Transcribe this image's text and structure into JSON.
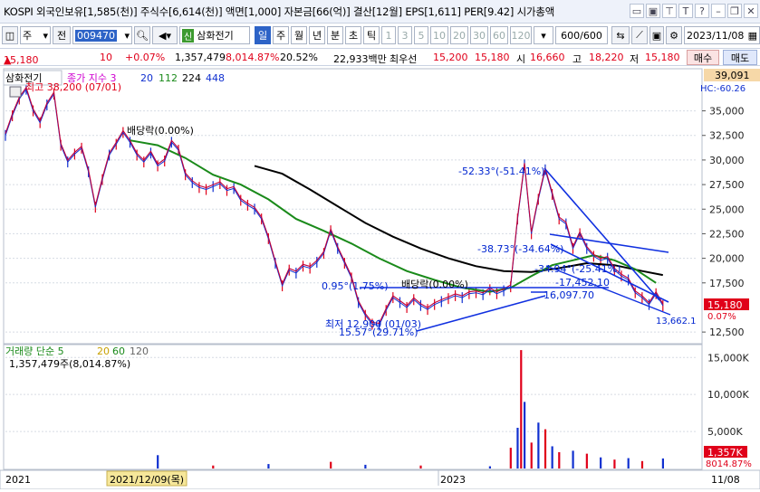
{
  "header": {
    "title": "KOSPI 외국인보유[1,585(천)] 주식수[6,614(천)] 액면[1,000] 자본금[66(억)] 결산[12월] EPS[1,611] PER[9.42] 시가총액"
  },
  "toolbar": {
    "type_select": "주",
    "type_btn": "전",
    "code": "009470",
    "badge": "신",
    "stock_name": "삼화전기",
    "period_tabs": [
      "일",
      "주",
      "월",
      "년",
      "분",
      "초",
      "틱"
    ],
    "active_period": "일",
    "intervals": [
      "1",
      "3",
      "5",
      "10",
      "20",
      "30",
      "60",
      "120"
    ],
    "count": "600/600",
    "date": "2023/11/08"
  },
  "quote": {
    "price": "15,180",
    "change": "10",
    "change_pct": "+0.07%",
    "volume": "1,357,479",
    "volume_pct": "8,014.87%",
    "turnover": "20.52%",
    "amount": "22,933백만",
    "pref_label": "최우선",
    "ask": "15,200",
    "bid": "15,180",
    "open_label": "시",
    "open": "16,660",
    "high_label": "고",
    "high": "18,220",
    "low_label": "저",
    "low": "15,180",
    "buy_btn": "매수",
    "sell_btn": "매도"
  },
  "chart_data": [
    {
      "type": "line",
      "title": "삼화전기",
      "legend": [
        "종가 지수 3",
        "20",
        "112",
        "224",
        "448"
      ],
      "legend_colors": [
        "#d000d0",
        "#1030d0",
        "#1a8a1a",
        "#000000",
        "#1030d0"
      ],
      "y_ticks": [
        "35,000",
        "32,500",
        "30,000",
        "27,500",
        "25,000",
        "22,500",
        "20,000",
        "17,500",
        "12,500"
      ],
      "y_top_label": "39,091",
      "hc_label": "HC:-60.26",
      "current_price_label": "15,180",
      "current_pct_label": "0.07%",
      "ylim": [
        11500,
        39100
      ],
      "price_line": [
        [
          0,
          32500
        ],
        [
          0.01,
          34500
        ],
        [
          0.02,
          36200
        ],
        [
          0.03,
          37200
        ],
        [
          0.04,
          35000
        ],
        [
          0.05,
          33800
        ],
        [
          0.06,
          35600
        ],
        [
          0.07,
          36700
        ],
        [
          0.08,
          31500
        ],
        [
          0.09,
          29800
        ],
        [
          0.1,
          30600
        ],
        [
          0.11,
          31200
        ],
        [
          0.12,
          28800
        ],
        [
          0.13,
          25200
        ],
        [
          0.14,
          28000
        ],
        [
          0.15,
          30500
        ],
        [
          0.16,
          31600
        ],
        [
          0.17,
          32800
        ],
        [
          0.18,
          31800
        ],
        [
          0.19,
          30500
        ],
        [
          0.2,
          29800
        ],
        [
          0.21,
          30700
        ],
        [
          0.22,
          29400
        ],
        [
          0.23,
          29900
        ],
        [
          0.24,
          31800
        ],
        [
          0.25,
          31000
        ],
        [
          0.26,
          28500
        ],
        [
          0.27,
          27700
        ],
        [
          0.28,
          27200
        ],
        [
          0.29,
          27000
        ],
        [
          0.3,
          27300
        ],
        [
          0.31,
          27600
        ],
        [
          0.32,
          26900
        ],
        [
          0.33,
          27100
        ],
        [
          0.34,
          25900
        ],
        [
          0.35,
          25400
        ],
        [
          0.36,
          25000
        ],
        [
          0.37,
          24000
        ],
        [
          0.38,
          22000
        ],
        [
          0.39,
          19500
        ],
        [
          0.4,
          17200
        ],
        [
          0.41,
          18800
        ],
        [
          0.42,
          18500
        ],
        [
          0.43,
          19200
        ],
        [
          0.44,
          19000
        ],
        [
          0.45,
          19600
        ],
        [
          0.46,
          20500
        ],
        [
          0.47,
          22800
        ],
        [
          0.48,
          21000
        ],
        [
          0.49,
          19500
        ],
        [
          0.5,
          18000
        ],
        [
          0.51,
          15500
        ],
        [
          0.52,
          14200
        ],
        [
          0.53,
          13300
        ],
        [
          0.54,
          13200
        ],
        [
          0.55,
          14700
        ],
        [
          0.56,
          16000
        ],
        [
          0.57,
          15500
        ],
        [
          0.58,
          15000
        ],
        [
          0.59,
          15800
        ],
        [
          0.6,
          15200
        ],
        [
          0.61,
          14800
        ],
        [
          0.62,
          15300
        ],
        [
          0.63,
          15600
        ],
        [
          0.64,
          15900
        ],
        [
          0.65,
          16200
        ],
        [
          0.66,
          16000
        ],
        [
          0.67,
          16400
        ],
        [
          0.68,
          16500
        ],
        [
          0.69,
          16300
        ],
        [
          0.7,
          16800
        ],
        [
          0.71,
          16400
        ],
        [
          0.72,
          16700
        ],
        [
          0.73,
          17100
        ],
        [
          0.74,
          24000
        ],
        [
          0.75,
          29500
        ],
        [
          0.76,
          22500
        ],
        [
          0.77,
          26000
        ],
        [
          0.78,
          29000
        ],
        [
          0.79,
          26500
        ],
        [
          0.8,
          24000
        ],
        [
          0.81,
          23500
        ],
        [
          0.82,
          21000
        ],
        [
          0.83,
          22500
        ],
        [
          0.84,
          21000
        ],
        [
          0.85,
          20200
        ],
        [
          0.86,
          19800
        ],
        [
          0.87,
          20000
        ],
        [
          0.88,
          18800
        ],
        [
          0.89,
          18200
        ],
        [
          0.9,
          17800
        ],
        [
          0.91,
          16500
        ],
        [
          0.92,
          16000
        ],
        [
          0.93,
          15300
        ],
        [
          0.94,
          16400
        ],
        [
          0.95,
          15180
        ]
      ],
      "ma_green": [
        [
          0.18,
          32000
        ],
        [
          0.22,
          31500
        ],
        [
          0.26,
          30200
        ],
        [
          0.3,
          28500
        ],
        [
          0.34,
          27500
        ],
        [
          0.38,
          26000
        ],
        [
          0.42,
          24000
        ],
        [
          0.46,
          22800
        ],
        [
          0.5,
          21500
        ],
        [
          0.54,
          20000
        ],
        [
          0.58,
          18700
        ],
        [
          0.62,
          17800
        ],
        [
          0.66,
          17000
        ],
        [
          0.7,
          16600
        ],
        [
          0.73,
          17000
        ],
        [
          0.76,
          18200
        ],
        [
          0.79,
          19300
        ],
        [
          0.82,
          19800
        ],
        [
          0.85,
          20300
        ],
        [
          0.88,
          19800
        ],
        [
          0.91,
          18900
        ],
        [
          0.94,
          17500
        ]
      ],
      "ma_black": [
        [
          0.36,
          29400
        ],
        [
          0.4,
          28600
        ],
        [
          0.44,
          27000
        ],
        [
          0.48,
          25300
        ],
        [
          0.52,
          23600
        ],
        [
          0.56,
          22200
        ],
        [
          0.6,
          21000
        ],
        [
          0.64,
          20000
        ],
        [
          0.68,
          19200
        ],
        [
          0.72,
          18700
        ],
        [
          0.76,
          18600
        ],
        [
          0.8,
          19000
        ],
        [
          0.84,
          19500
        ],
        [
          0.88,
          19300
        ],
        [
          0.92,
          18700
        ],
        [
          0.95,
          18300
        ]
      ],
      "trendlines": [
        {
          "label": "-52.33°(-51.41%)"
        },
        {
          "label": "-38.73°(-34.64%)"
        },
        {
          "label": "-34.94°(-25.41%)"
        },
        {
          "label": "-17,452,10"
        },
        {
          "label": "16,097.70"
        },
        {
          "label": "0.95°(1.75%)"
        },
        {
          "label": "15.57°(29.71%)"
        },
        {
          "label": "13,662.1"
        }
      ],
      "annotations": [
        {
          "text": "최고 38,200 (07/01)"
        },
        {
          "text": "배당락(0.00%)"
        },
        {
          "text": "배당락(0.00%)"
        },
        {
          "text": "최저 12,900 (01/03)"
        }
      ]
    },
    {
      "type": "bar",
      "title": "거래량",
      "legend": [
        "거래량 단순 5",
        "20",
        "60",
        "120"
      ],
      "legend_colors": [
        "#1a8a1a",
        "#c000c0",
        "#c8a000",
        "#1a8a1a",
        "#666666"
      ],
      "current_label": "1,357,479주(8,014.87%)",
      "y_ticks": [
        "15,000K",
        "10,000K",
        "5,000K"
      ],
      "ylim": [
        0,
        16500
      ],
      "right_labels": [
        "1,357K",
        "8014.87%"
      ],
      "x_labels": [
        "2021",
        "2021/12/09(목)",
        "2023",
        "11/08"
      ],
      "volume_bars": [
        [
          0.22,
          1800
        ],
        [
          0.3,
          400
        ],
        [
          0.38,
          600
        ],
        [
          0.47,
          900
        ],
        [
          0.52,
          500
        ],
        [
          0.6,
          400
        ],
        [
          0.7,
          300
        ],
        [
          0.73,
          2800
        ],
        [
          0.74,
          5500
        ],
        [
          0.745,
          16000
        ],
        [
          0.75,
          9000
        ],
        [
          0.76,
          3500
        ],
        [
          0.77,
          6200
        ],
        [
          0.78,
          5300
        ],
        [
          0.79,
          3000
        ],
        [
          0.8,
          2200
        ],
        [
          0.82,
          2400
        ],
        [
          0.84,
          2000
        ],
        [
          0.86,
          1500
        ],
        [
          0.88,
          1200
        ],
        [
          0.9,
          1400
        ],
        [
          0.92,
          1000
        ],
        [
          0.95,
          1357
        ]
      ]
    }
  ]
}
